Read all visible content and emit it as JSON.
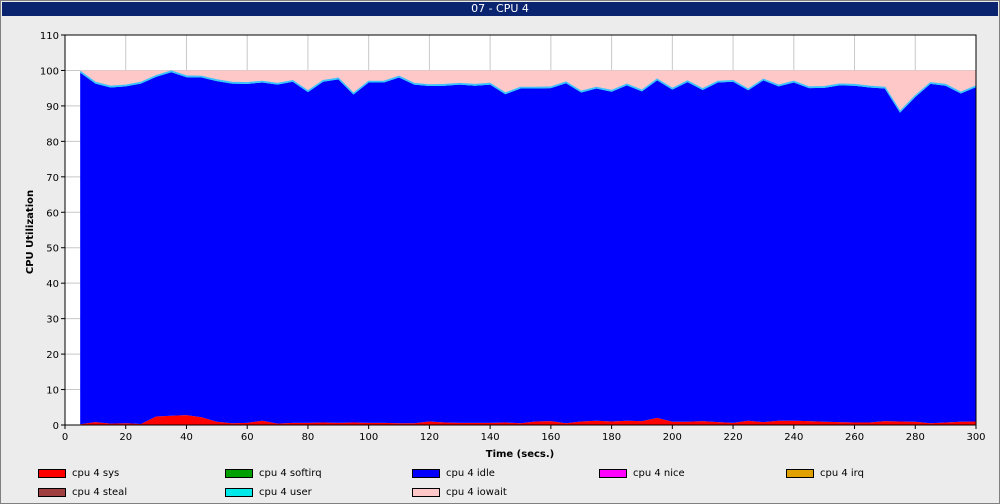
{
  "window": {
    "title": "07 - CPU 4"
  },
  "chart_data": {
    "type": "area",
    "stacked": true,
    "xlabel": "Time (secs.)",
    "ylabel": "CPU Utilization",
    "xlim": [
      0,
      300
    ],
    "ylim": [
      0,
      110
    ],
    "xticks": [
      0,
      20,
      40,
      60,
      80,
      100,
      120,
      140,
      160,
      180,
      200,
      220,
      240,
      260,
      280,
      300
    ],
    "yticks": [
      0,
      10,
      20,
      30,
      40,
      50,
      60,
      70,
      80,
      90,
      100,
      110
    ],
    "grid": true,
    "legend_position": "bottom",
    "x": [
      5,
      10,
      15,
      20,
      25,
      30,
      35,
      40,
      45,
      50,
      55,
      60,
      65,
      70,
      75,
      80,
      85,
      90,
      95,
      100,
      105,
      110,
      115,
      120,
      125,
      130,
      135,
      140,
      145,
      150,
      155,
      160,
      165,
      170,
      175,
      180,
      185,
      190,
      195,
      200,
      205,
      210,
      215,
      220,
      225,
      230,
      235,
      240,
      245,
      250,
      255,
      260,
      265,
      270,
      275,
      280,
      285,
      290,
      295,
      300
    ],
    "series": [
      {
        "name": "cpu 4 sys",
        "color": "#ff0000",
        "values": [
          0.2,
          0.8,
          0.4,
          0.5,
          0.3,
          2.4,
          2.6,
          2.8,
          2.2,
          0.9,
          0.5,
          0.6,
          1.2,
          0.4,
          0.6,
          0.6,
          0.7,
          0.6,
          0.7,
          0.6,
          0.6,
          0.5,
          0.5,
          1.0,
          0.7,
          0.6,
          0.6,
          0.6,
          0.7,
          0.5,
          1.0,
          1.1,
          0.5,
          1.0,
          1.2,
          1.0,
          1.2,
          1.1,
          2.0,
          0.9,
          0.9,
          1.1,
          0.8,
          0.6,
          1.2,
          0.8,
          1.2,
          1.2,
          1.1,
          0.9,
          0.8,
          0.7,
          0.7,
          1.1,
          1.0,
          0.9,
          0.5,
          0.7,
          0.9,
          1.0
        ]
      },
      {
        "name": "cpu 4 softirq",
        "color": "#00a000",
        "values": [
          0,
          0,
          0,
          0,
          0,
          0,
          0,
          0,
          0,
          0,
          0,
          0,
          0,
          0,
          0,
          0,
          0,
          0,
          0,
          0,
          0,
          0,
          0,
          0,
          0,
          0,
          0,
          0,
          0,
          0,
          0,
          0,
          0,
          0,
          0,
          0,
          0,
          0,
          0,
          0,
          0,
          0,
          0,
          0,
          0,
          0,
          0,
          0,
          0,
          0,
          0,
          0,
          0,
          0,
          0,
          0,
          0,
          0,
          0,
          0
        ]
      },
      {
        "name": "cpu 4 idle",
        "color": "#0000ff",
        "values": [
          99.2,
          95.5,
          94.8,
          95.0,
          96.0,
          95.8,
          96.9,
          95.3,
          95.8,
          96.1,
          95.8,
          95.6,
          95.4,
          95.6,
          96.2,
          93.3,
          96.1,
          96.9,
          92.5,
          96.0,
          96.0,
          97.5,
          95.5,
          94.6,
          95.0,
          95.4,
          95.1,
          95.4,
          92.6,
          94.4,
          93.9,
          93.9,
          95.9,
          92.8,
          93.7,
          93.0,
          94.6,
          93.0,
          95.2,
          93.7,
          95.8,
          93.4,
          95.8,
          96.2,
          93.2,
          96.4,
          94.3,
          95.4,
          93.9,
          94.2,
          95.0,
          95.0,
          94.5,
          93.8,
          87.1,
          91.6,
          95.7,
          95.0,
          92.6,
          94.3
        ]
      },
      {
        "name": "cpu 4 nice",
        "color": "#ff00ff",
        "values": [
          0,
          0,
          0,
          0,
          0,
          0,
          0,
          0,
          0,
          0,
          0,
          0,
          0,
          0,
          0,
          0,
          0,
          0,
          0,
          0,
          0,
          0,
          0,
          0,
          0,
          0,
          0,
          0,
          0,
          0,
          0,
          0,
          0,
          0,
          0,
          0,
          0,
          0,
          0,
          0,
          0,
          0,
          0,
          0,
          0,
          0,
          0,
          0,
          0,
          0,
          0,
          0,
          0,
          0,
          0,
          0,
          0,
          0,
          0,
          0
        ]
      },
      {
        "name": "cpu 4 irq",
        "color": "#e0a000",
        "values": [
          0,
          0,
          0,
          0,
          0,
          0,
          0,
          0,
          0,
          0,
          0,
          0,
          0,
          0,
          0,
          0,
          0,
          0,
          0,
          0,
          0,
          0,
          0,
          0,
          0,
          0,
          0,
          0,
          0,
          0,
          0,
          0,
          0,
          0,
          0,
          0,
          0,
          0,
          0,
          0,
          0,
          0,
          0,
          0,
          0,
          0,
          0,
          0,
          0,
          0,
          0,
          0,
          0,
          0,
          0,
          0,
          0,
          0,
          0,
          0
        ]
      },
      {
        "name": "cpu 4 steal",
        "color": "#a04040",
        "values": [
          0,
          0,
          0,
          0,
          0,
          0,
          0,
          0,
          0,
          0,
          0,
          0,
          0,
          0,
          0,
          0,
          0,
          0,
          0,
          0,
          0,
          0,
          0,
          0,
          0,
          0,
          0,
          0,
          0,
          0,
          0,
          0,
          0,
          0,
          0,
          0,
          0,
          0,
          0,
          0,
          0,
          0,
          0,
          0,
          0,
          0,
          0,
          0,
          0,
          0,
          0,
          0,
          0,
          0,
          0,
          0,
          0,
          0,
          0,
          0
        ]
      },
      {
        "name": "cpu 4 user",
        "color": "#00e8e8",
        "values": [
          0.3,
          0.3,
          0.3,
          0.3,
          0.3,
          0.3,
          0.3,
          0.3,
          0.3,
          0.3,
          0.3,
          0.3,
          0.3,
          0.3,
          0.3,
          0.3,
          0.3,
          0.3,
          0.3,
          0.3,
          0.3,
          0.3,
          0.3,
          0.3,
          0.3,
          0.3,
          0.3,
          0.3,
          0.3,
          0.3,
          0.3,
          0.3,
          0.3,
          0.3,
          0.3,
          0.3,
          0.3,
          0.3,
          0.3,
          0.3,
          0.3,
          0.3,
          0.3,
          0.3,
          0.3,
          0.3,
          0.3,
          0.3,
          0.3,
          0.3,
          0.3,
          0.3,
          0.3,
          0.3,
          0.3,
          0.3,
          0.3,
          0.3,
          0.3,
          0.3
        ]
      },
      {
        "name": "cpu 4 iowait",
        "color": "#ffc8c8",
        "values": [
          0.3,
          3.4,
          4.5,
          4.2,
          3.4,
          1.5,
          0.2,
          1.6,
          1.7,
          2.7,
          3.4,
          3.5,
          3.1,
          3.7,
          2.9,
          5.8,
          2.9,
          2.2,
          6.5,
          3.1,
          3.1,
          1.7,
          3.7,
          4.1,
          4.0,
          3.7,
          4.0,
          3.7,
          6.4,
          4.8,
          4.8,
          4.7,
          3.3,
          5.9,
          4.8,
          5.7,
          3.9,
          5.6,
          2.5,
          5.1,
          3.0,
          5.2,
          3.1,
          2.9,
          5.3,
          2.5,
          4.2,
          3.1,
          4.7,
          4.6,
          3.9,
          4.0,
          4.5,
          4.8,
          11.6,
          7.2,
          3.5,
          4.0,
          6.2,
          4.4
        ]
      }
    ]
  }
}
